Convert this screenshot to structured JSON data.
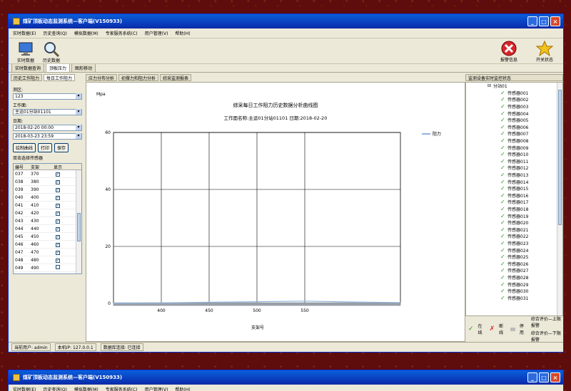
{
  "window": {
    "title": "煤矿顶板动态监测系统—客户端(V150933)",
    "minimize": "_",
    "maximize": "□",
    "close": "×"
  },
  "menu": [
    "实时数据(E)",
    "历史查询(Q)",
    "模拟数据(M)",
    "专家服务系统(C)",
    "用户管理(V)",
    "帮助(H)"
  ],
  "toolbar": {
    "realtime": "实时数据",
    "history": "历史数据",
    "alarm": "报警信息",
    "switch": "开关状态"
  },
  "doc_tabs": [
    "实时数据查询",
    "顶板压力",
    "图形移动"
  ],
  "left": {
    "subtabs": [
      "历史工作阻力",
      "每日工作阻力"
    ],
    "area_label": "测区:",
    "area_value": "123",
    "face_label": "工作面:",
    "face_value": "主运01分站01101",
    "date_label": "日期:",
    "date_from": "2018-02-20 00:00",
    "date_to": "2018-03-23 23:59",
    "buttons": [
      "绘制曲线",
      "打印",
      "保存"
    ],
    "table_title": "双击选择传感器",
    "columns": [
      "编号",
      "支架",
      "显示"
    ],
    "rows": [
      {
        "id": "037",
        "support": "370",
        "checked": true
      },
      {
        "id": "038",
        "support": "380",
        "checked": true
      },
      {
        "id": "039",
        "support": "390",
        "checked": true
      },
      {
        "id": "040",
        "support": "400",
        "checked": true
      },
      {
        "id": "041",
        "support": "410",
        "checked": true
      },
      {
        "id": "042",
        "support": "420",
        "checked": true
      },
      {
        "id": "043",
        "support": "430",
        "checked": true
      },
      {
        "id": "044",
        "support": "440",
        "checked": true
      },
      {
        "id": "045",
        "support": "450",
        "checked": true
      },
      {
        "id": "046",
        "support": "460",
        "checked": true
      },
      {
        "id": "047",
        "support": "470",
        "checked": true
      },
      {
        "id": "048",
        "support": "480",
        "checked": true
      },
      {
        "id": "049",
        "support": "490",
        "checked": false
      }
    ]
  },
  "center": {
    "subtabs": [
      "应力分布分析",
      "初撑力和阻力分析",
      "综采监测报表"
    ]
  },
  "chart_data": {
    "type": "line",
    "title": "综采每日工作阻力历史数据分析曲线图",
    "subtitle": "工作面名称:主运01分站01101 日期:2018-02-20",
    "ylabel": "Mpa",
    "xlabel": "支架号",
    "ylim": [
      0,
      60
    ],
    "xlim": [
      350,
      650
    ],
    "yticks": [
      0,
      20,
      40,
      60
    ],
    "xticks": [
      400,
      450,
      500,
      550
    ],
    "grid": true,
    "legend": "top-right",
    "series": [
      {
        "name": "阻力",
        "color": "#8fb4dc",
        "x": [
          350,
          400,
          450,
          500,
          550,
          600,
          650
        ],
        "y": [
          0.1,
          0.2,
          0.4,
          0.6,
          0.8,
          0.5,
          0.3
        ]
      }
    ]
  },
  "right": {
    "header": "监测设备实时监控状态",
    "root": "分站01",
    "sensors": [
      "传感器001",
      "传感器002",
      "传感器003",
      "传感器004",
      "传感器005",
      "传感器006",
      "传感器007",
      "传感器008",
      "传感器009",
      "传感器010",
      "传感器011",
      "传感器012",
      "传感器013",
      "传感器014",
      "传感器015",
      "传感器016",
      "传感器017",
      "传感器018",
      "传感器019",
      "传感器020",
      "传感器021",
      "传感器022",
      "传感器023",
      "传感器024",
      "传感器025",
      "传感器026",
      "传感器027",
      "传感器028",
      "传感器029",
      "传感器030",
      "传感器031"
    ],
    "legend": [
      "在线",
      "断线",
      "停用",
      "综合评价—上限报警",
      "综合评价—下限报警"
    ]
  },
  "status": {
    "user": "当前用户: admin",
    "ip": "本机IP: 127.0.0.1",
    "db": "数据库连接: 已连接"
  },
  "second_window": {
    "title": "煤矿顶板动态监测系统—客户端(V150933)"
  }
}
